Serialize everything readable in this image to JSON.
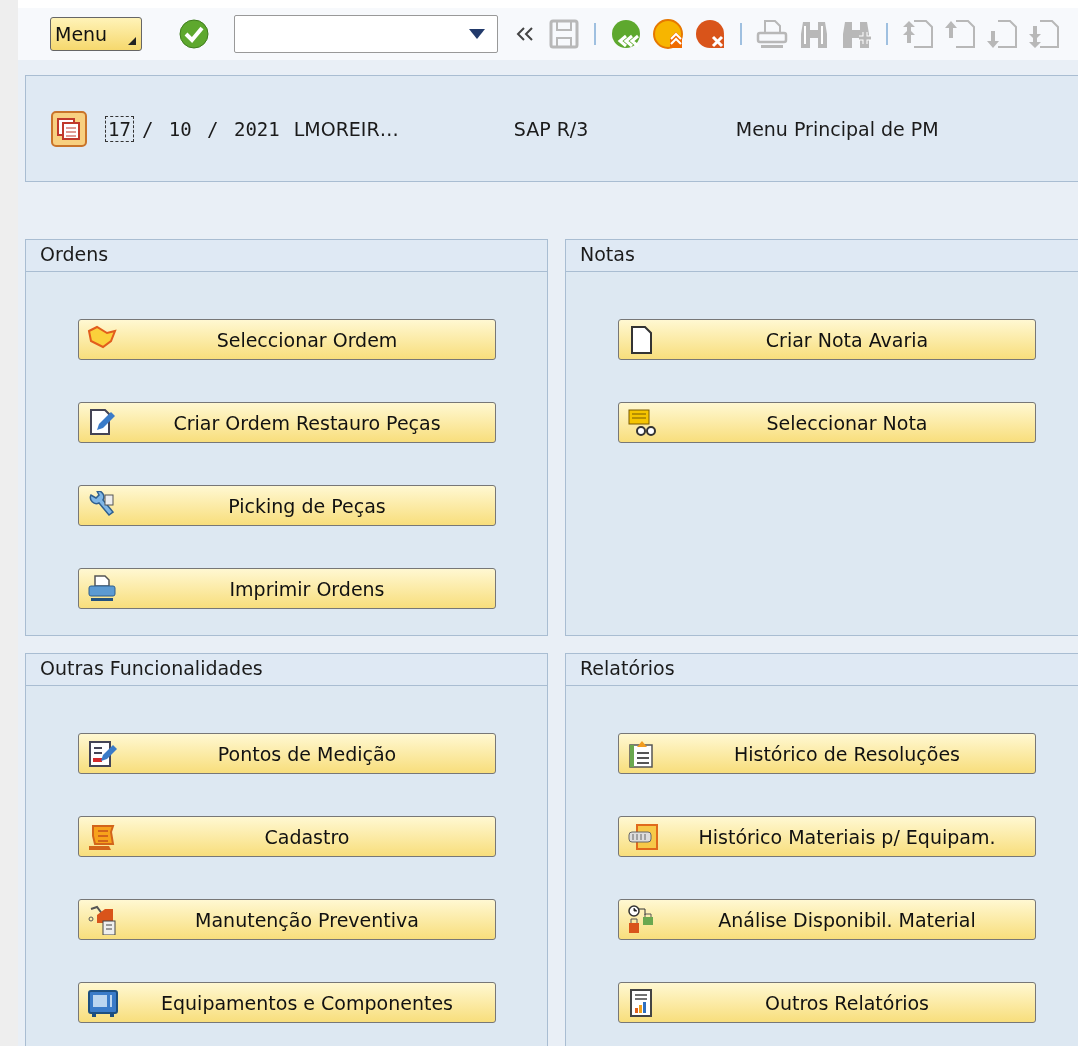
{
  "toolbar": {
    "menu_button": "Menu",
    "icons": [
      {
        "disabled": false
      },
      {
        "disabled": true
      },
      {
        "disabled": false
      },
      {
        "disabled": false
      },
      {
        "disabled": false
      },
      {
        "disabled": true
      },
      {
        "disabled": true
      },
      {
        "disabled": true
      },
      {
        "disabled": true
      },
      {
        "disabled": true
      },
      {
        "disabled": true
      },
      {
        "disabled": true
      }
    ]
  },
  "header": {
    "day": "17",
    "date_rest": "/ 10 / 2021",
    "user": "LMOREIR…",
    "system": "SAP R/3",
    "title": "Menu Principal de PM"
  },
  "panels": [
    {
      "title": "Ordens",
      "buttons": [
        "Seleccionar Ordem",
        "Criar Ordem Restauro Peças",
        "Picking de Peças",
        "Imprimir Ordens"
      ]
    },
    {
      "title": "Notas",
      "buttons": [
        "Criar Nota Avaria",
        "Seleccionar Nota"
      ]
    },
    {
      "title": "Outras Funcionalidades",
      "buttons": [
        "Pontos de Medição",
        "Cadastro",
        "Manutenção Preventiva",
        "Equipamentos e Componentes"
      ]
    },
    {
      "title": "Relatórios",
      "buttons": [
        "Histórico de Resoluções",
        "Histórico Materiais p/ Equipam.",
        "Análise Disponibil. Material",
        "Outros Relatórios"
      ]
    }
  ]
}
